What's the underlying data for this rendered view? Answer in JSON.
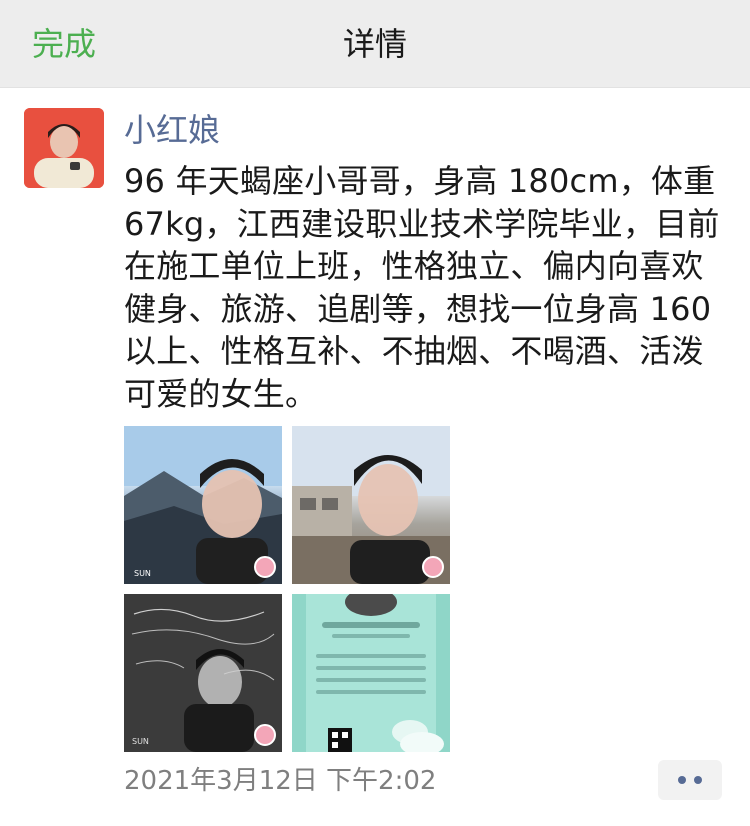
{
  "navbar": {
    "done_label": "完成",
    "title": "详情"
  },
  "post": {
    "author": "小红娘",
    "content": "96 年天蝎座小哥哥，身高 180cm，体重 67kg，江西建设职业技术学院毕业，目前在施工单位上班，性格独立、偏内向喜欢健身、旅游、追剧等，想找一位身高 160 以上、性格互补、不抽烟、不喝酒、活泼可爱的女生。",
    "timestamp": "2021年3月12日 下午2:02",
    "photos": [
      {
        "desc": "man-selfie-mountain"
      },
      {
        "desc": "man-selfie-building"
      },
      {
        "desc": "man-poster-dark"
      },
      {
        "desc": "member-card-poster"
      }
    ]
  },
  "colors": {
    "accent_green": "#4caf50",
    "nickname_blue": "#576b95",
    "navbar_bg": "#ededed"
  }
}
